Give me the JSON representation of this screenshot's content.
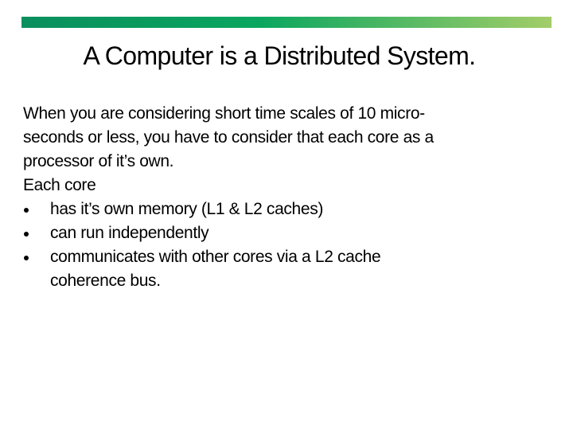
{
  "slide": {
    "accent_bar": {
      "color_start": "#0A8F5E",
      "color_mid": "#0AA65F",
      "color_end": "#A3CD69"
    },
    "title": "A Computer is a Distributed System.",
    "intro_lines": [
      "When you are considering short time scales of 10 micro-",
      "seconds or less, you have to consider that each core as a",
      "processor of it’s own."
    ],
    "list_heading": "Each core",
    "bullets": [
      {
        "icon": "bullet-dot-icon",
        "lines": [
          "has it’s own memory (L1 & L2 caches)"
        ]
      },
      {
        "icon": "bullet-dot-icon",
        "lines": [
          "can run independently"
        ]
      },
      {
        "icon": "bullet-dot-icon",
        "lines": [
          "communicates with other cores via a L2 cache",
          "coherence bus."
        ]
      }
    ]
  }
}
